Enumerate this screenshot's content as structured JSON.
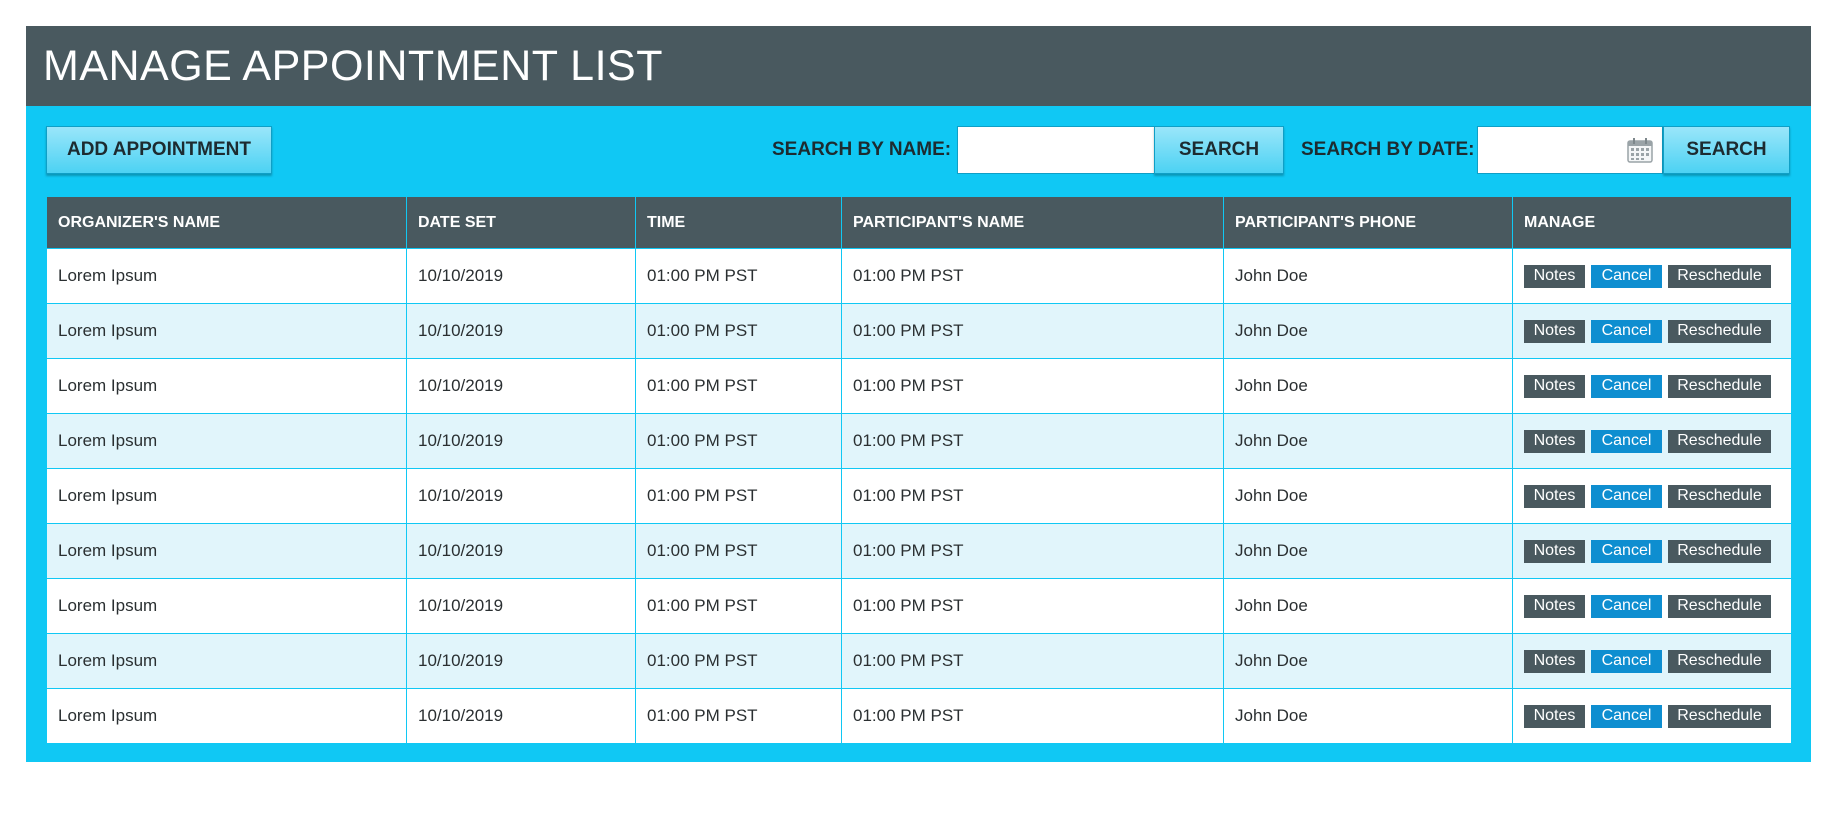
{
  "header": {
    "title": "MANAGE APPOINTMENT LIST"
  },
  "toolbar": {
    "add_label": "ADD APPOINTMENT",
    "search_name_label": "SEARCH BY NAME:",
    "search_name_value": "",
    "search_button_label": "SEARCH",
    "search_date_label": "SEARCH BY DATE:",
    "search_date_value": "",
    "search_date_button_label": "SEARCH"
  },
  "colors": {
    "panel": "#10c8f4",
    "header": "#49595f",
    "row_alt": "#e1f5fb",
    "cancel": "#0e8ed0"
  },
  "icons": {
    "date": "calendar-icon"
  },
  "table": {
    "columns": [
      "ORGANIZER'S NAME",
      "DATE SET",
      "TIME",
      "PARTICIPANT'S NAME",
      "PARTICIPANT'S PHONE",
      "MANAGE"
    ],
    "actions": {
      "notes": "Notes",
      "cancel": "Cancel",
      "reschedule": "Reschedule"
    },
    "rows": [
      [
        "Lorem Ipsum",
        "10/10/2019",
        "01:00 PM PST",
        "01:00 PM PST",
        "John Doe"
      ],
      [
        "Lorem Ipsum",
        "10/10/2019",
        "01:00 PM PST",
        "01:00 PM PST",
        "John Doe"
      ],
      [
        "Lorem Ipsum",
        "10/10/2019",
        "01:00 PM PST",
        "01:00 PM PST",
        "John Doe"
      ],
      [
        "Lorem Ipsum",
        "10/10/2019",
        "01:00 PM PST",
        "01:00 PM PST",
        "John Doe"
      ],
      [
        "Lorem Ipsum",
        "10/10/2019",
        "01:00 PM PST",
        "01:00 PM PST",
        "John Doe"
      ],
      [
        "Lorem Ipsum",
        "10/10/2019",
        "01:00 PM PST",
        "01:00 PM PST",
        "John Doe"
      ],
      [
        "Lorem Ipsum",
        "10/10/2019",
        "01:00 PM PST",
        "01:00 PM PST",
        "John Doe"
      ],
      [
        "Lorem Ipsum",
        "10/10/2019",
        "01:00 PM PST",
        "01:00 PM PST",
        "John Doe"
      ],
      [
        "Lorem Ipsum",
        "10/10/2019",
        "01:00 PM PST",
        "01:00 PM PST",
        "John Doe"
      ]
    ]
  }
}
